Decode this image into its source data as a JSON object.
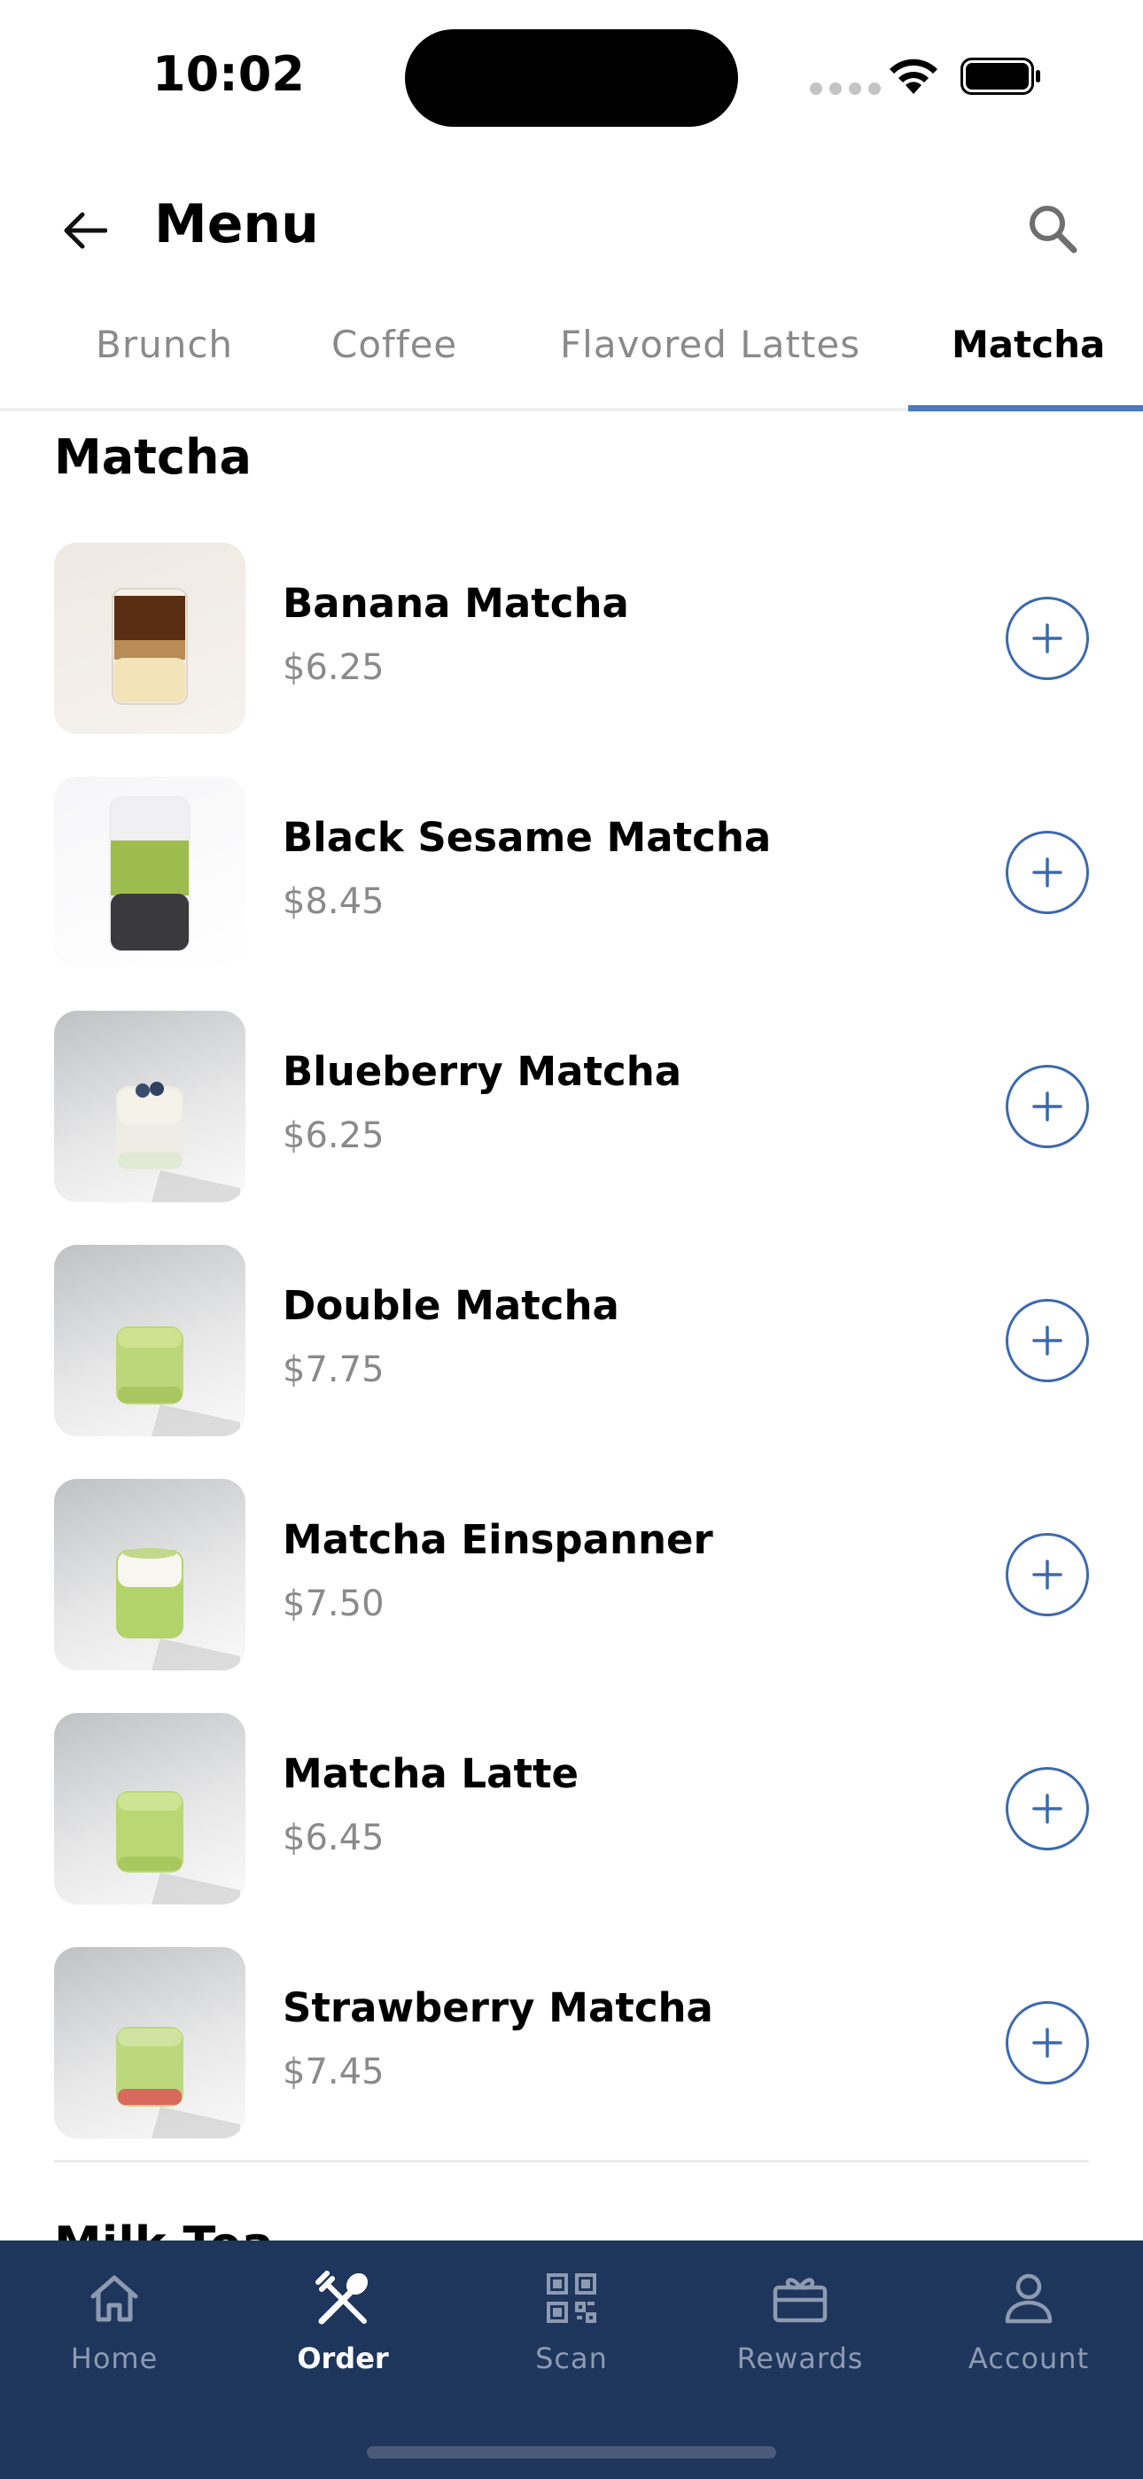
{
  "status_bar": {
    "time": "10:02"
  },
  "header": {
    "title": "Menu"
  },
  "tabs": [
    {
      "label": "Brunch"
    },
    {
      "label": "Coffee"
    },
    {
      "label": "Flavored Lattes"
    },
    {
      "label": "Matcha",
      "active": true
    }
  ],
  "section": {
    "title": "Matcha",
    "items": [
      {
        "name": "Banana Matcha",
        "price": "$6.25"
      },
      {
        "name": "Black Sesame Matcha",
        "price": "$8.45"
      },
      {
        "name": "Blueberry Matcha",
        "price": "$6.25"
      },
      {
        "name": "Double Matcha",
        "price": "$7.75"
      },
      {
        "name": "Matcha Einspanner",
        "price": "$7.50"
      },
      {
        "name": "Matcha Latte",
        "price": "$6.45"
      },
      {
        "name": "Strawberry Matcha",
        "price": "$7.45"
      }
    ]
  },
  "next_section": {
    "title": "Milk Tea"
  },
  "bottom_nav": {
    "items": [
      {
        "label": "Home",
        "icon": "home-icon"
      },
      {
        "label": "Order",
        "icon": "fork-knife-icon",
        "active": true
      },
      {
        "label": "Scan",
        "icon": "qr-code-icon"
      },
      {
        "label": "Rewards",
        "icon": "gift-card-icon"
      },
      {
        "label": "Account",
        "icon": "person-icon"
      }
    ]
  },
  "colors": {
    "accent": "#3d69ad",
    "tab_indicator": "#4a78bd",
    "nav_background": "#1e355c",
    "nav_inactive": "#8d9ab1",
    "price_gray": "#8a8a8a"
  }
}
